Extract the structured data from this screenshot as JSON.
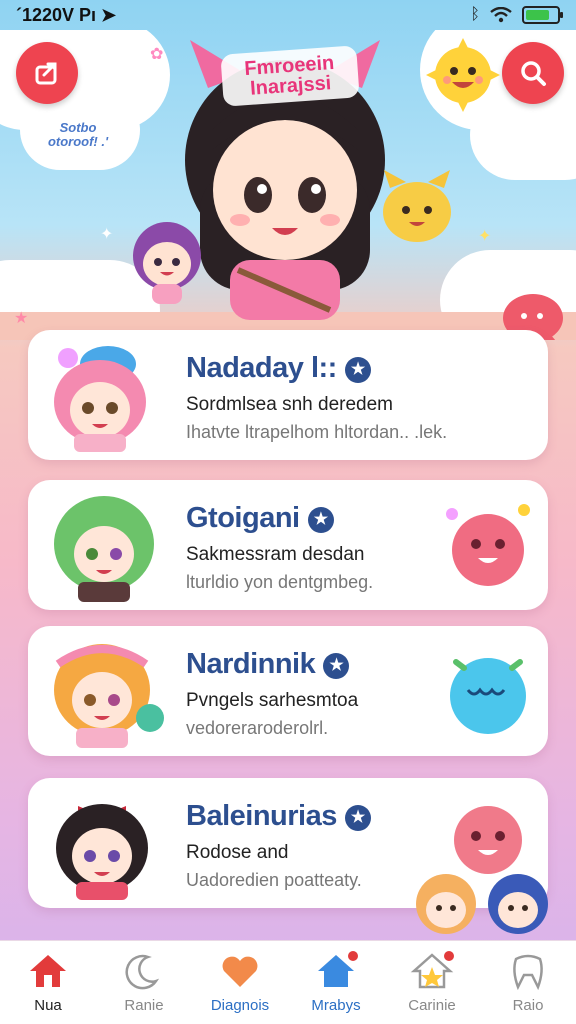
{
  "status_bar": {
    "time": "´1220V Pı ➤",
    "bluetooth": "ᛒ",
    "battery_level": 0.75
  },
  "hero": {
    "title": "Fmroeein Inarajssi",
    "badge_line1": "Sotbo",
    "badge_line2": "otoroof! .'",
    "left_button_icon": "share-icon",
    "right_button_icon": "search-icon"
  },
  "cards": [
    {
      "name": "Nadaday l::",
      "subtitle": "Sordmlsea snh deredem",
      "description": "Ihatvte ltrapelhom hltordan.. .lek.",
      "avatar": "pink-hair-girl",
      "accent": "#f39ab8"
    },
    {
      "name": "Gtoigani",
      "subtitle": "Sakmessram desdan",
      "description": "lturldio yon dentgmbeg.",
      "avatar": "green-hair-girl",
      "accent": "#f06c82"
    },
    {
      "name": "Nardinnik",
      "subtitle": "Pvngels sarhesmtoa",
      "description": "vedoreraroderolrl.",
      "avatar": "orange-hair-girl",
      "accent": "#4bc6ec"
    },
    {
      "name": "Baleinurias",
      "subtitle": "Rodose and",
      "description": "Uadoredien poatteaty.",
      "avatar": "red-bow-girl",
      "accent": "#f07a8a"
    }
  ],
  "tabs": [
    {
      "label": "Nua",
      "icon": "home-icon",
      "active": true
    },
    {
      "label": "Ranie",
      "icon": "moon-icon",
      "active": false
    },
    {
      "label": "Diagnois",
      "icon": "heart-icon",
      "active": false
    },
    {
      "label": "Mrabys",
      "icon": "house-badge-icon",
      "active": false,
      "badge": true
    },
    {
      "label": "Carinie",
      "icon": "star-house-icon",
      "active": false,
      "badge": true
    },
    {
      "label": "Raio",
      "icon": "tooth-icon",
      "active": false
    }
  ],
  "colors": {
    "brand_red": "#ee4450",
    "name_blue": "#2d4f8f",
    "tab_active": "#e23b3b"
  }
}
